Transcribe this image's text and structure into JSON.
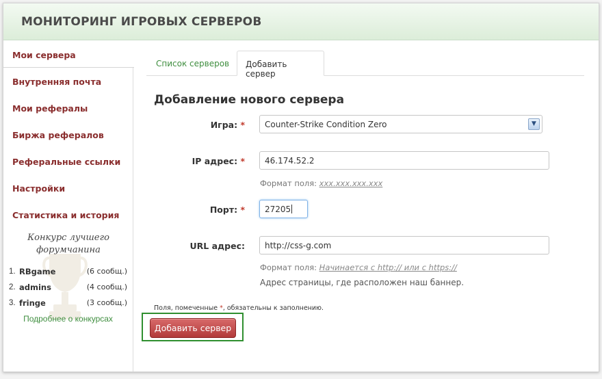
{
  "header": {
    "title": "МОНИТОРИНГ ИГРОВЫХ СЕРВЕРОВ"
  },
  "sidebar": {
    "items": [
      {
        "label": "Мои сервера"
      },
      {
        "label": "Внутренняя почта"
      },
      {
        "label": "Мои рефералы"
      },
      {
        "label": "Биржа рефералов"
      },
      {
        "label": "Реферальные ссылки"
      },
      {
        "label": "Настройки"
      },
      {
        "label": "Статистика и история"
      }
    ],
    "active_item": "Мои сервера",
    "contest": {
      "title_line1": "Конкурс лучшего",
      "title_line2": "форумчанина",
      "entries": [
        {
          "rank": "1.",
          "name": "RBgame",
          "count": "(6 сообщ.)"
        },
        {
          "rank": "2.",
          "name": "admins",
          "count": "(4 сообщ.)"
        },
        {
          "rank": "3.",
          "name": "fringe",
          "count": "(3 сообщ.)"
        }
      ],
      "more_link": "Подробнее о конкурсах"
    }
  },
  "tabs": [
    {
      "label": "Список серверов"
    },
    {
      "label": "Добавить сервер"
    }
  ],
  "active_tab": "Добавить сервер",
  "form": {
    "title": "Добавление нового сервера",
    "required_mark": "*",
    "game": {
      "label": "Игра:",
      "value": "Counter-Strike Condition Zero"
    },
    "ip": {
      "label": "IP адрес:",
      "value": "46.174.52.2",
      "hint_prefix": "Формат поля:",
      "hint_example": "xxx.xxx.xxx.xxx"
    },
    "port": {
      "label": "Порт:",
      "value": "27205"
    },
    "url": {
      "label": "URL адрес:",
      "value": "http://css-g.com",
      "hint_prefix": "Формат поля:",
      "hint_example": "Начинается с http:// или с https://",
      "description": "Адрес страницы, где расположен наш баннер."
    },
    "note_before": "Поля, помеченные ",
    "note_mark": "*",
    "note_after": ", обязательны к заполнению.",
    "submit_label": "Добавить сервер"
  },
  "colors": {
    "header_bg": "#dcedd9",
    "nav_text": "#8a2e2e",
    "link_green": "#3f8e3f",
    "required_red": "#c0392b",
    "submit_bg": "#b23a3a",
    "highlight_frame": "#2f8f2f"
  },
  "icons": {
    "select_arrow": "chevron-down-icon",
    "contest_trophy": "trophy-icon"
  }
}
